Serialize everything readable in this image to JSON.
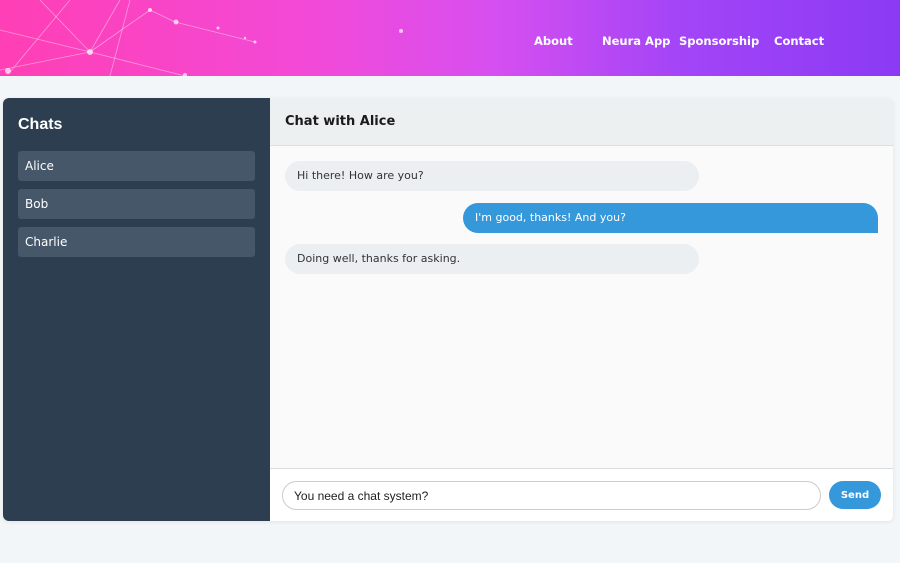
{
  "colors": {
    "header_gradient_start": "#ff3fb5",
    "header_gradient_end": "#8b3af4",
    "sidebar_bg": "#2c3e50",
    "contact_bg": "#46576a",
    "accent": "#3498db",
    "incoming_bubble": "#eceff1"
  },
  "nav": {
    "items": [
      {
        "label": "About"
      },
      {
        "label": "Neura App"
      },
      {
        "label": "Sponsorship"
      },
      {
        "label": "Contact"
      }
    ]
  },
  "sidebar": {
    "title": "Chats",
    "contacts": [
      {
        "name": "Alice"
      },
      {
        "name": "Bob"
      },
      {
        "name": "Charlie"
      }
    ]
  },
  "chat": {
    "title": "Chat with Alice",
    "messages": [
      {
        "direction": "incoming",
        "text": "Hi there! How are you?"
      },
      {
        "direction": "outgoing",
        "text": "I'm good, thanks! And you?"
      },
      {
        "direction": "incoming",
        "text": "Doing well, thanks for asking."
      }
    ]
  },
  "composer": {
    "value": "You need a chat system?",
    "send_label": "Send"
  }
}
